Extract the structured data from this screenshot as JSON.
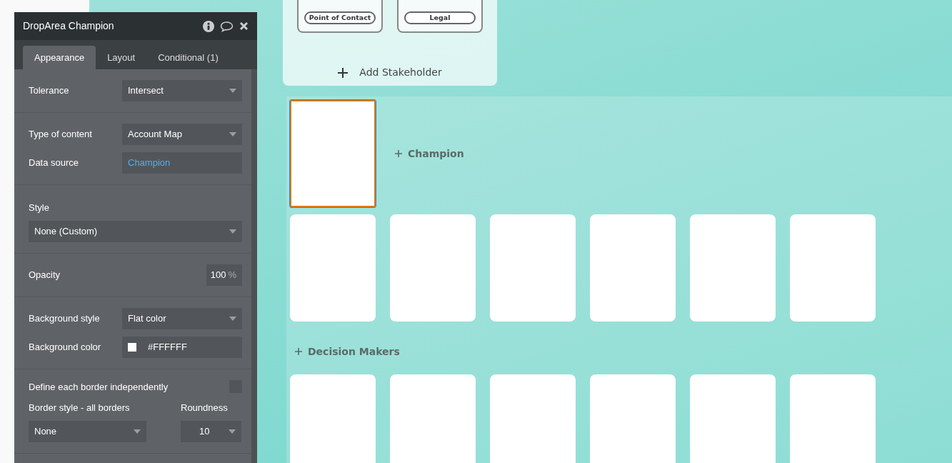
{
  "panel": {
    "title": "DropArea Champion",
    "tabs": [
      {
        "label": "Appearance",
        "selected": true
      },
      {
        "label": "Layout",
        "selected": false
      },
      {
        "label": "Conditional (1)",
        "selected": false
      }
    ],
    "sections": [
      {
        "rows": [
          {
            "kind": "select",
            "label": "Tolerance",
            "value": "Intersect"
          }
        ]
      },
      {
        "rows": [
          {
            "kind": "select",
            "label": "Type of content",
            "value": "Account Map"
          },
          {
            "kind": "expression",
            "label": "Data source",
            "value": "Champion"
          }
        ]
      },
      {
        "rows": [
          {
            "kind": "stacked-select",
            "label": "Style",
            "value": "None (Custom)"
          }
        ]
      },
      {
        "rows": [
          {
            "kind": "number",
            "label": "Opacity",
            "value": "100",
            "unit": "%"
          }
        ]
      },
      {
        "rows": [
          {
            "kind": "select",
            "label": "Background style",
            "value": "Flat color"
          },
          {
            "kind": "color",
            "label": "Background color",
            "value": "#FFFFFF",
            "color": "#ffffff"
          }
        ]
      },
      {
        "rows": [
          {
            "kind": "checkbox",
            "label": "Define each border independently",
            "checked": false
          },
          {
            "kind": "split",
            "left": {
              "label": "Border style - all borders",
              "value": "None"
            },
            "right": {
              "label": "Roundness",
              "value": "10"
            }
          }
        ]
      }
    ]
  },
  "canvas": {
    "stakeholders": {
      "cards": [
        {
          "role": "Point of Contact"
        },
        {
          "role": "Legal"
        }
      ],
      "add_label": "Add Stakeholder"
    },
    "sections": [
      {
        "kind": "inline-label",
        "label": "Champion",
        "cards": [
          {
            "selected": true
          }
        ]
      },
      {
        "kind": "grid",
        "cards": [
          {
            "selected": false
          },
          {
            "selected": false
          },
          {
            "selected": false
          },
          {
            "selected": false
          },
          {
            "selected": false
          },
          {
            "selected": false
          }
        ]
      },
      {
        "kind": "headed",
        "label": "Decision Makers",
        "cards": [
          {
            "selected": false
          },
          {
            "selected": false
          },
          {
            "selected": false
          },
          {
            "selected": false
          },
          {
            "selected": false
          },
          {
            "selected": false
          }
        ]
      }
    ]
  }
}
